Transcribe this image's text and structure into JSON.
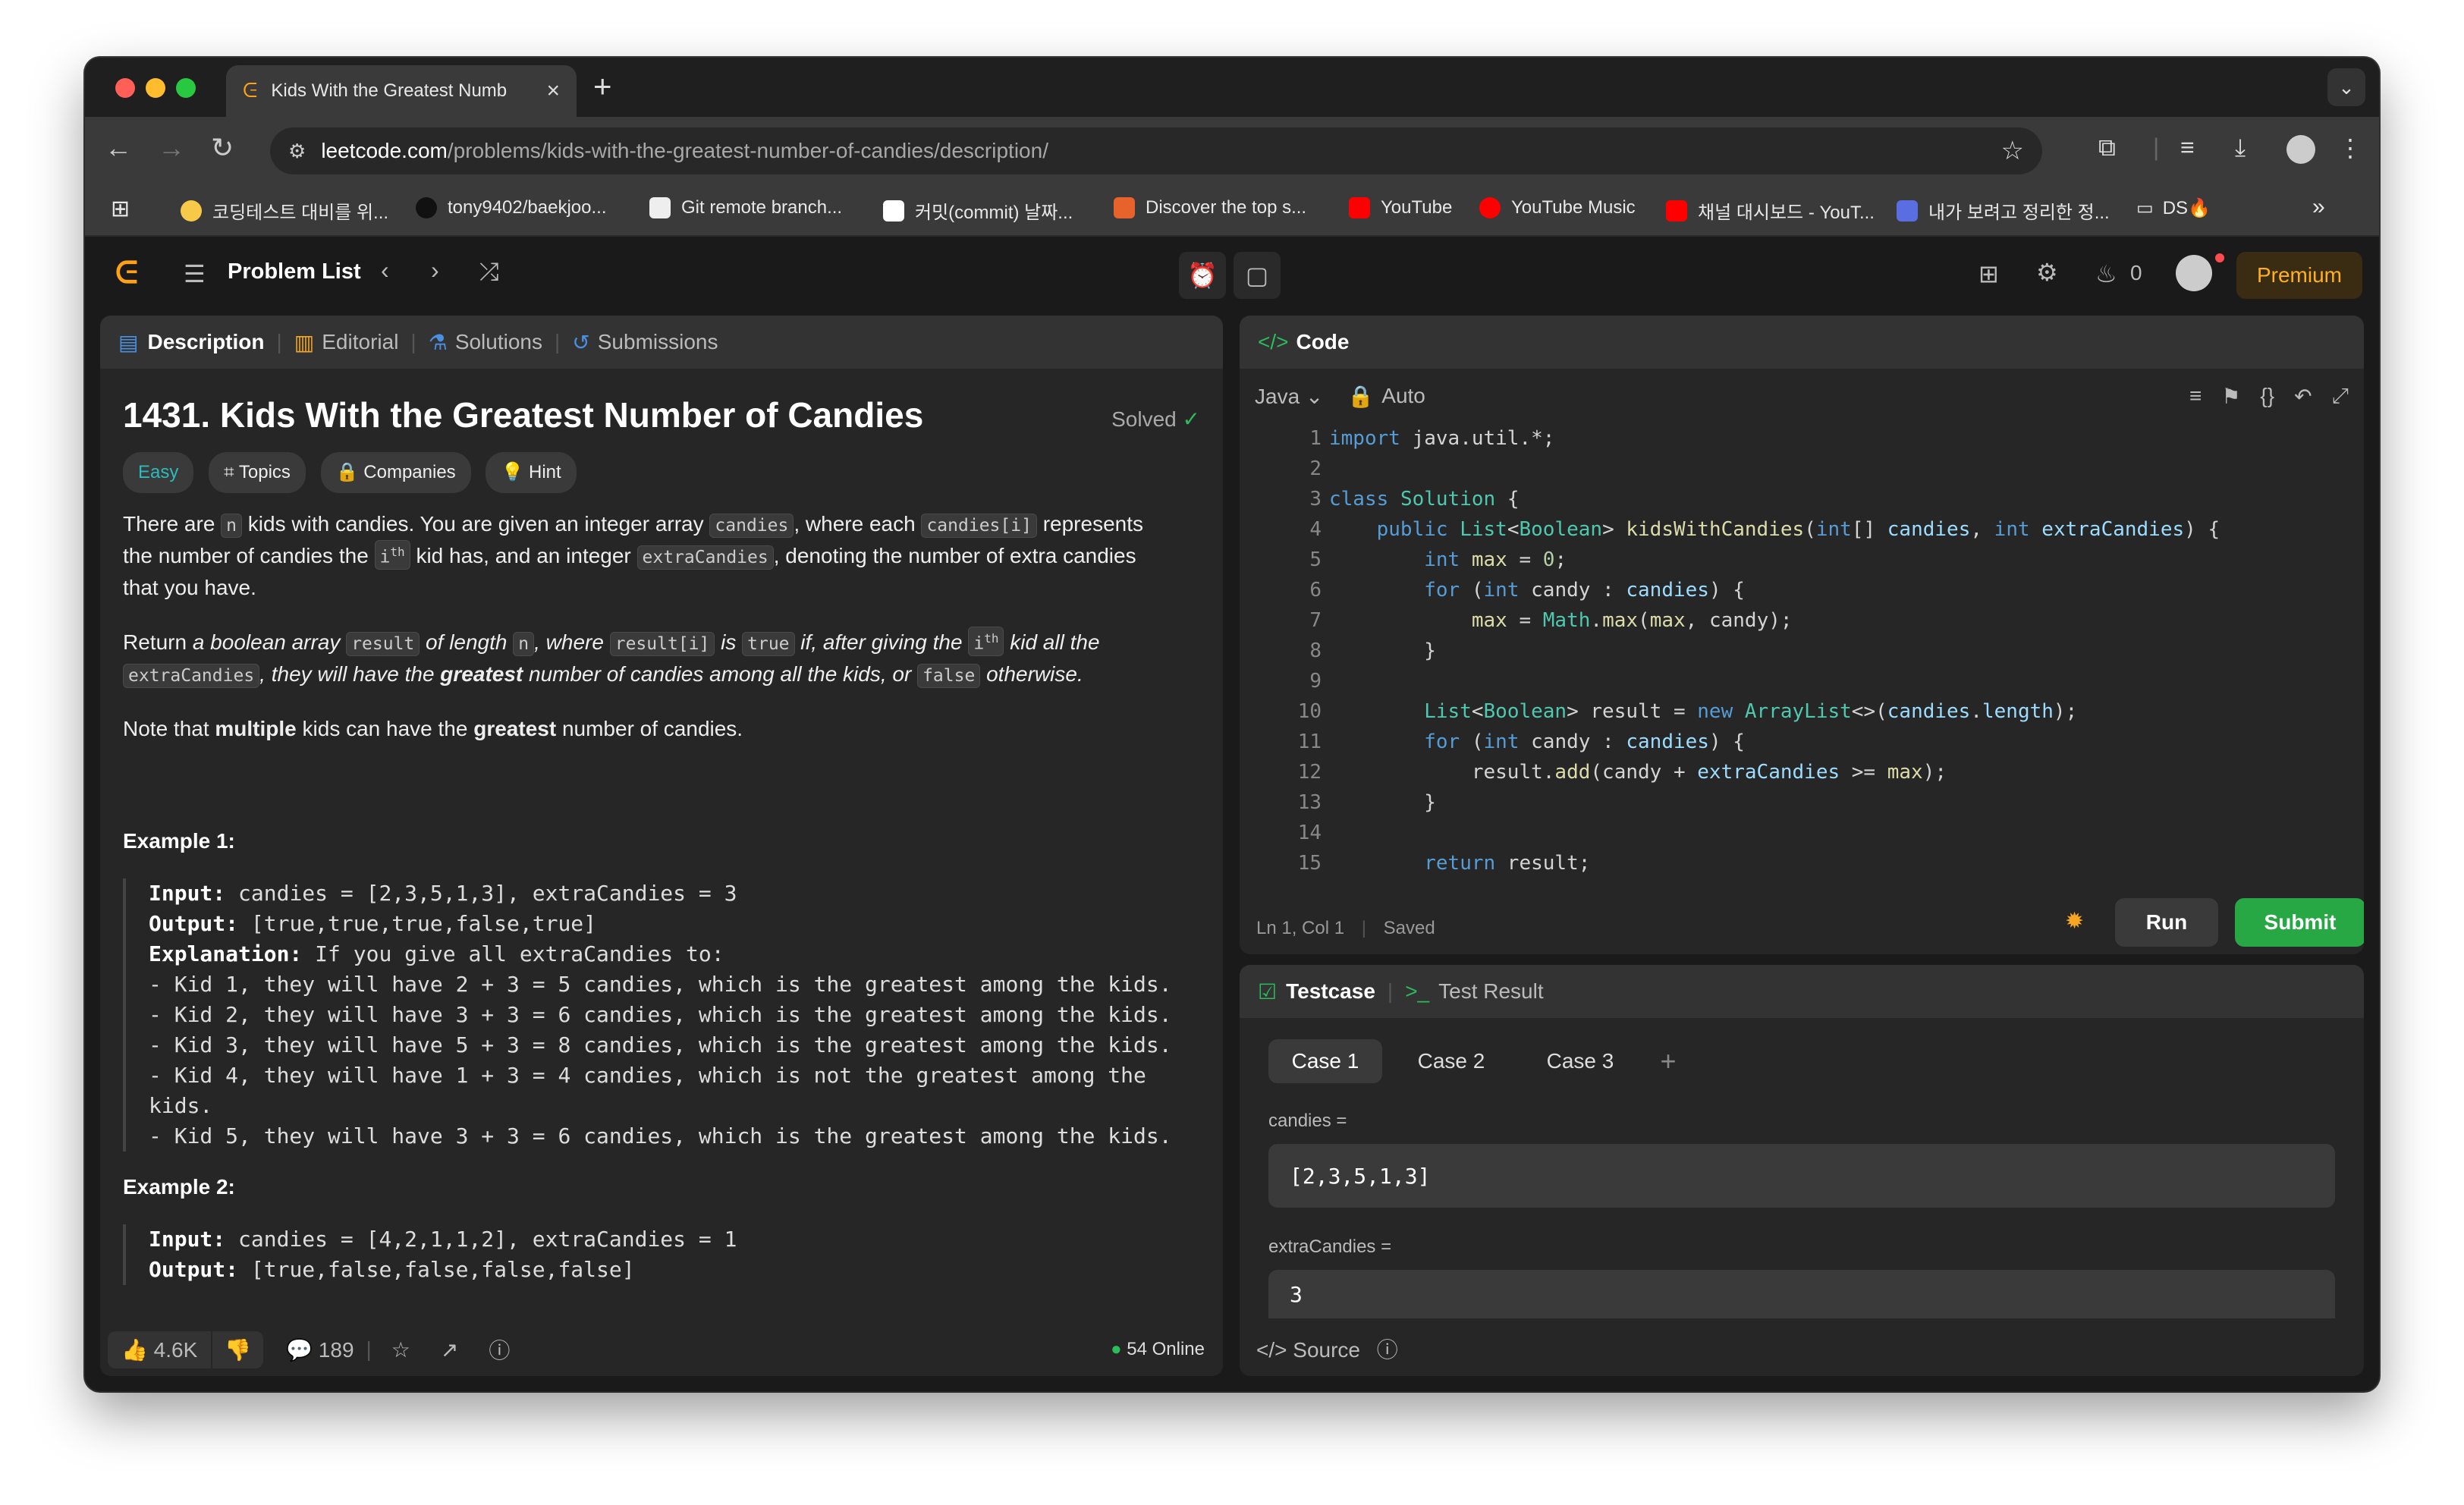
{
  "browser": {
    "tab_title": "Kids With the Greatest Numb",
    "url_host": "leetcode.com",
    "url_path": "/problems/kids-with-the-greatest-number-of-candies/description/",
    "bookmarks": [
      "코딩테스트 대비를 위...",
      "tony9402/baekjoo...",
      "Git remote branch...",
      "커밋(commit) 날짜...",
      "Discover the top s...",
      "YouTube",
      "YouTube Music",
      "채널 대시보드 - YouT...",
      "내가 보려고 정리한 정...",
      "DS🔥",
      "»"
    ]
  },
  "leetcode": {
    "problem_list": "Problem List",
    "streak": "0",
    "premium": "Premium"
  },
  "desc_panel": {
    "tabs": {
      "description": "Description",
      "editorial": "Editorial",
      "solutions": "Solutions",
      "submissions": "Submissions"
    },
    "title": "1431. Kids With the Greatest Number of Candies",
    "solved": "Solved",
    "chips": {
      "difficulty": "Easy",
      "topics": "Topics",
      "companies": "Companies",
      "hint": "Hint"
    },
    "p1": {
      "a": "There are ",
      "n": "n",
      "b": " kids with candies. You are given an integer array ",
      "candies": "candies",
      "c": ", where each ",
      "candies_i": "candies[i]",
      "d": " represents",
      "e": "the number of candies the ",
      "ith": "i",
      "th": "th",
      "f": " kid has, and an integer ",
      "extra": "extraCandies",
      "g": ", denoting the number of extra candies",
      "h": "that you have."
    },
    "p2": {
      "a": "Return ",
      "b": "a boolean array ",
      "result": "result",
      "c": " of length ",
      "n": "n",
      "d": ", where ",
      "result_i": "result[i]",
      "e": " is ",
      "true": "true",
      "f": " if, after giving the ",
      "ith": "i",
      "th": "th",
      "g": " kid all the",
      "extra": "extraCandies",
      "h": ", they will have the ",
      "greatest": "greatest",
      "i": " number of candies among all the kids, or ",
      "false": "false",
      "j": " otherwise."
    },
    "p3": {
      "a": "Note that ",
      "multiple": "multiple",
      "b": " kids can have the ",
      "greatest": "greatest",
      "c": " number of candies."
    },
    "ex1_title": "Example 1:",
    "ex1": {
      "in_label": "Input:",
      "in_val": " candies = [2,3,5,1,3], extraCandies = 3",
      "out_label": "Output:",
      "out_val": " [true,true,true,false,true]",
      "exp_label": "Explanation:",
      "exp_val": " If you give all extraCandies to:",
      "l1": "- Kid 1, they will have 2 + 3 = 5 candies, which is the greatest among the kids.",
      "l2": "- Kid 2, they will have 3 + 3 = 6 candies, which is the greatest among the kids.",
      "l3": "- Kid 3, they will have 5 + 3 = 8 candies, which is the greatest among the kids.",
      "l4": "- Kid 4, they will have 1 + 3 = 4 candies, which is not the greatest among the",
      "l4b": "kids.",
      "l5": "- Kid 5, they will have 3 + 3 = 6 candies, which is the greatest among the kids."
    },
    "ex2_title": "Example 2:",
    "ex2": {
      "in_label": "Input:",
      "in_val": " candies = [4,2,1,1,2], extraCandies = 1",
      "out_label": "Output:",
      "out_val": " [true,false,false,false,false]"
    },
    "footer": {
      "likes": "4.6K",
      "comments": "189",
      "online": "54 Online"
    }
  },
  "code_panel": {
    "title": "Code",
    "language": "Java",
    "mode": "Auto",
    "status": "Ln 1, Col 1",
    "saved": "Saved",
    "run": "Run",
    "submit": "Submit",
    "line_numbers": [
      "1",
      "2",
      "3",
      "4",
      "5",
      "6",
      "7",
      "8",
      "9",
      "10",
      "11",
      "12",
      "13",
      "14",
      "15"
    ],
    "lines": [
      "import java.util.*;",
      "",
      "class Solution {",
      "    public List<Boolean> kidsWithCandies(int[] candies, int extraCandies) {",
      "        int max = 0;",
      "        for (int candy : candies) {",
      "            max = Math.max(max, candy);",
      "        }",
      "",
      "        List<Boolean> result = new ArrayList<>(candies.length);",
      "        for (int candy : candies) {",
      "            result.add(candy + extraCandies >= max);",
      "        }",
      "",
      "        return result;"
    ]
  },
  "test_panel": {
    "testcase_tab": "Testcase",
    "result_tab": "Test Result",
    "cases": [
      "Case 1",
      "Case 2",
      "Case 3"
    ],
    "candies_label": "candies =",
    "candies_value": "[2,3,5,1,3]",
    "extra_label": "extraCandies =",
    "extra_value": "3",
    "source": "Source"
  }
}
